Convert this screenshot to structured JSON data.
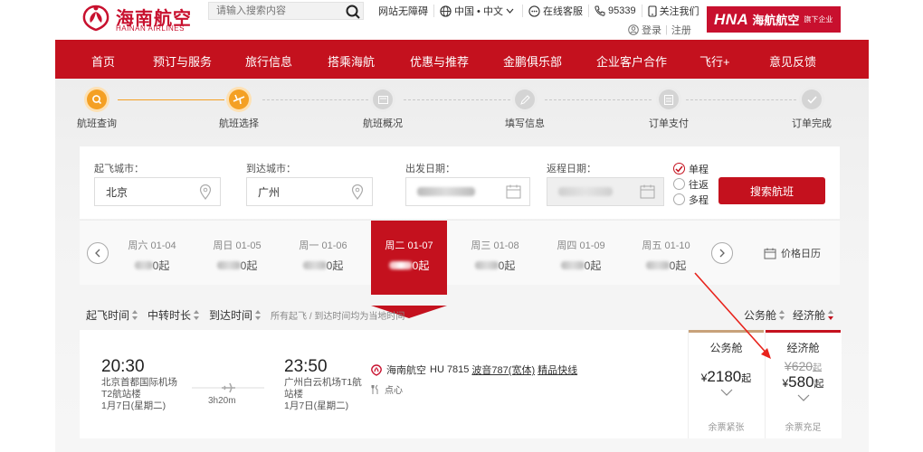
{
  "header": {
    "logo_cn": "海南航空",
    "logo_en": "HAINAN AIRLINES",
    "search_placeholder": "请输入搜索内容",
    "links": {
      "accessibility": "网站无障碍",
      "region": "中国 • 中文",
      "online_service": "在线客服",
      "phone": "95339",
      "wechat": "关注我们"
    },
    "login": "登录",
    "register": "注册",
    "badge_en": "HNA",
    "badge_cn": "海航航空",
    "badge_sub": "旗下企业"
  },
  "nav": [
    "首页",
    "预订与服务",
    "旅行信息",
    "搭乘海航",
    "优惠与推荐",
    "金鹏俱乐部",
    "企业客户合作",
    "飞行+",
    "意见反馈"
  ],
  "progress": [
    {
      "label": "航班查询",
      "active": true
    },
    {
      "label": "航班选择",
      "active": true
    },
    {
      "label": "航班概况",
      "active": false
    },
    {
      "label": "填写信息",
      "active": false
    },
    {
      "label": "订单支付",
      "active": false
    },
    {
      "label": "订单完成",
      "active": false
    }
  ],
  "form": {
    "from_label": "起飞城市：",
    "from_value": "北京",
    "to_label": "到达城市：",
    "to_value": "广州",
    "depart_label": "出发日期：",
    "return_label": "返程日期：",
    "trip_types": [
      {
        "label": "单程",
        "checked": true
      },
      {
        "label": "往返",
        "checked": false
      },
      {
        "label": "多程",
        "checked": false
      }
    ],
    "search_button": "搜索航班"
  },
  "dates": [
    {
      "day": "周六",
      "date": "01-04",
      "price_suffix": "0起",
      "selected": false
    },
    {
      "day": "周日",
      "date": "01-05",
      "price_suffix": "0起",
      "selected": false
    },
    {
      "day": "周一",
      "date": "01-06",
      "price_suffix": "0起",
      "selected": false
    },
    {
      "day": "周二",
      "date": "01-07",
      "price_suffix": "0起",
      "selected": true
    },
    {
      "day": "周三",
      "date": "01-08",
      "price_suffix": "0起",
      "selected": false
    },
    {
      "day": "周四",
      "date": "01-09",
      "price_suffix": "0起",
      "selected": false
    },
    {
      "day": "周五",
      "date": "01-10",
      "price_suffix": "0起",
      "selected": false
    }
  ],
  "price_calendar": "价格日历",
  "sort": {
    "dep_time": "起飞时间",
    "transfer": "中转时长",
    "arr_time": "到达时间",
    "note": "所有起飞 / 到达时间均为当地时间",
    "business": "公务舱",
    "economy": "经济舱"
  },
  "flight": {
    "dep_time": "20:30",
    "dep_airport": "北京首都国际机场",
    "dep_terminal": "T2航站楼",
    "dep_date": "1月7日(星期二)",
    "duration": "3h20m",
    "arr_time": "23:50",
    "arr_airport": "广州白云机场T1航",
    "arr_terminal": "站楼",
    "arr_date": "1月7日(星期二)",
    "airline": "海南航空",
    "flight_no": "HU 7815",
    "aircraft": "波音787(宽体)",
    "product": "精品快线",
    "meal": "点心"
  },
  "fares": {
    "business": {
      "name": "公务舱",
      "currency": "¥",
      "price": "2180",
      "suffix": "起",
      "status": "余票紧张",
      "accent": "#c8a27a"
    },
    "economy": {
      "name": "经济舱",
      "currency": "¥",
      "old_price": "620",
      "price": "580",
      "suffix": "起",
      "status": "余票充足",
      "accent": "#c4111e"
    }
  },
  "colors": {
    "brand": "#c4111e",
    "step_active": "#f4a024"
  }
}
